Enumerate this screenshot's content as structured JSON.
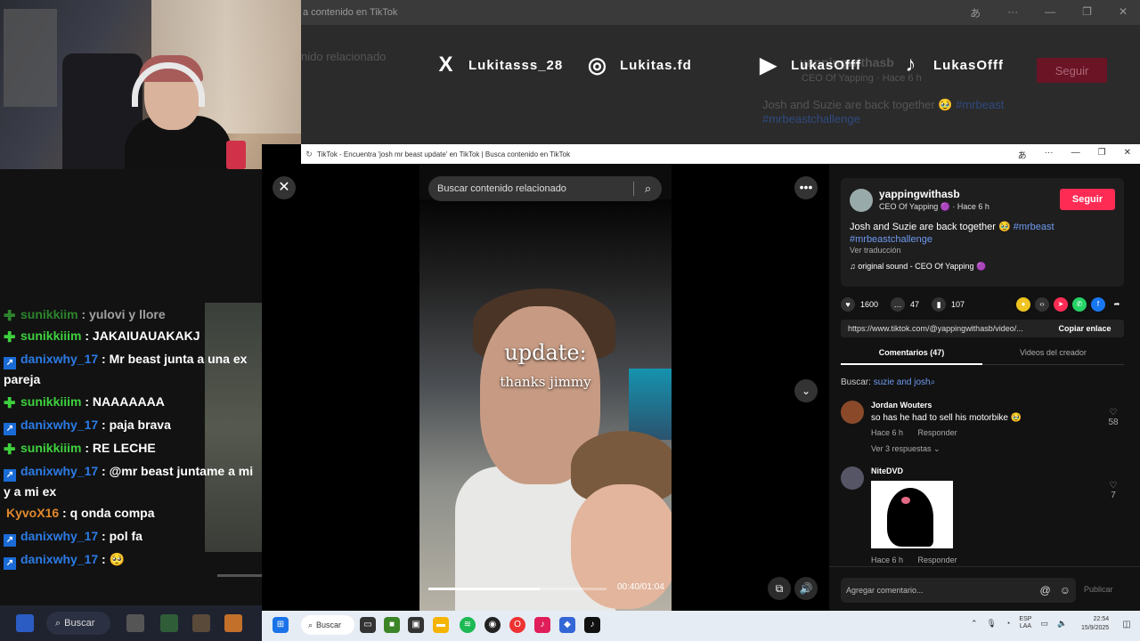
{
  "background_window": {
    "title": "a contenido en TikTok",
    "search_placeholder": "nido relacionado",
    "username": "yappingwithasb",
    "sub": "CEO Of Yapping  ·  Hace 6 h",
    "follow": "Seguir",
    "caption": "Josh and Suzie are back together 🥹",
    "tag1": "#mrbeast",
    "tag2": "#mrbeastchallenge",
    "ctrl_a": "あ",
    "ctrl_more": "···",
    "ctrl_min": "—",
    "ctrl_max": "❐",
    "ctrl_close": "✕"
  },
  "socials": [
    {
      "icon": "X",
      "handle": "Lukitasss_28"
    },
    {
      "icon": "◎",
      "handle": "Lukitas.fd"
    },
    {
      "icon": "▶",
      "handle": "LukasOfff"
    },
    {
      "icon": "♪",
      "handle": "LukasOfff"
    }
  ],
  "chat": [
    {
      "badge": "green",
      "user": "sunikkiiim",
      "text": "JAKAIUAUAKAKJ",
      "color": "green"
    },
    {
      "badge": "blue",
      "user": "danixwhy_17",
      "text": "Mr beast junta a una ex pareja",
      "color": "blue"
    },
    {
      "badge": "green",
      "user": "sunikkiiim",
      "text": "NAAAAAAA",
      "color": "green"
    },
    {
      "badge": "blue",
      "user": "danixwhy_17",
      "text": "paja brava",
      "color": "blue"
    },
    {
      "badge": "green",
      "user": "sunikkiiim",
      "text": "RE LECHE",
      "color": "green"
    },
    {
      "badge": "blue",
      "user": "danixwhy_17",
      "text": "@mr beast juntame a mi y a mi ex",
      "color": "blue"
    },
    {
      "badge": "none",
      "user": "KyvoX16",
      "text": "q onda compa",
      "color": "orange"
    },
    {
      "badge": "blue",
      "user": "danixwhy_17",
      "text": "pol fa",
      "color": "blue"
    },
    {
      "badge": "blue",
      "user": "danixwhy_17",
      "text": "🥺",
      "color": "blue"
    }
  ],
  "chat_partial": {
    "user": "sunikkiim",
    "text": "yulovi y llore"
  },
  "window": {
    "title": "TikTok - Encuentra 'josh mr beast update' en TikTok | Busca contenido en TikTok",
    "ctrl_a": "あ",
    "ctrl_more": "···",
    "ctrl_min": "—",
    "ctrl_max": "❐",
    "ctrl_close": "✕"
  },
  "video": {
    "search_placeholder": "Buscar contenido relacionado",
    "overlay_line1": "update:",
    "overlay_line2": "thanks jimmy",
    "time": "00:40/01:04",
    "progress": 0.625
  },
  "post": {
    "username": "yappingwithasb",
    "sub": "CEO Of Yapping 🟣 · Hace 6 h",
    "follow": "Seguir",
    "caption": "Josh and Suzie are back together 🥹",
    "tag1": "#mrbeast",
    "tag2": "#mrbeastchallenge",
    "translate": "Ver traducción",
    "sound": "♫  original sound - CEO Of Yapping 🟣",
    "likes": "1600",
    "comments": "47",
    "saves": "107",
    "link": "https://www.tiktok.com/@yappingwithasb/video/...",
    "copy": "Copiar enlace"
  },
  "tabs": {
    "comments": "Comentarios (47)",
    "creator": "Videos del creador"
  },
  "search_term": {
    "label": "Buscar:",
    "term": "suzie and josh⌕"
  },
  "comments": [
    {
      "user": "Jordan Wouters",
      "text": "so has he had to sell his motorbike 🥹",
      "time": "Hace 6 h",
      "reply": "Responder",
      "replies": "Ver 3 respuestas ⌄",
      "likes": "58"
    },
    {
      "user": "NiteDVD",
      "text": "",
      "time": "Hace 6 h",
      "reply": "Responder",
      "likes": "7"
    }
  ],
  "add_comment": {
    "placeholder": "Agregar comentario...",
    "publish": "Publicar"
  },
  "taskbar_left": {
    "search": "Buscar"
  },
  "taskbar": {
    "search": "Buscar",
    "lang_top": "ESP",
    "lang_bottom": "LAA",
    "time": "22:54",
    "date": "15/9/2025"
  },
  "colors": {
    "tiktok_red": "#fe2c55",
    "link_blue": "#6e9af0",
    "chat_green": "#3ed13e",
    "chat_blue": "#2c7be5",
    "chat_orange": "#e2892d"
  }
}
